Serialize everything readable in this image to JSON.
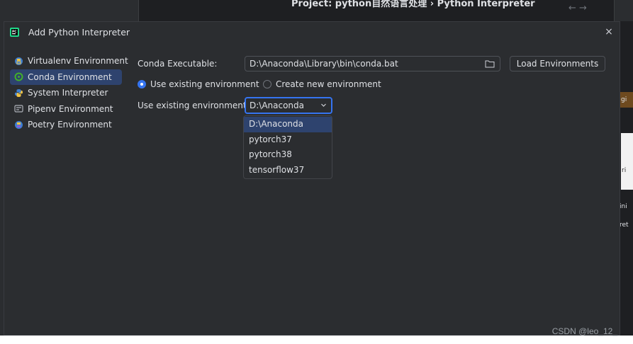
{
  "background": {
    "breadcrumb": "Project: python自然语言处理 › Python Interpreter",
    "nav_arrows": "← →",
    "right_fragments": [
      "gi",
      "ri",
      "ini",
      "ret"
    ]
  },
  "dialog": {
    "title": "Add Python Interpreter",
    "close_label": "×"
  },
  "sidebar": {
    "items": [
      {
        "label": "Virtualenv Environment",
        "icon": "virtualenv-icon",
        "selected": false
      },
      {
        "label": "Conda Environment",
        "icon": "conda-icon",
        "selected": true
      },
      {
        "label": "System Interpreter",
        "icon": "python-icon",
        "selected": false
      },
      {
        "label": "Pipenv Environment",
        "icon": "pipenv-icon",
        "selected": false
      },
      {
        "label": "Poetry Environment",
        "icon": "poetry-icon",
        "selected": false
      }
    ]
  },
  "form": {
    "conda_executable_label": "Conda Executable:",
    "conda_executable_value": "D:\\Anaconda\\Library\\bin\\conda.bat",
    "load_button": "Load Environments",
    "radio_existing": "Use existing environment",
    "radio_new": "Create new environment",
    "existing_env_label": "Use existing environment:",
    "existing_env_value": "D:\\Anaconda",
    "env_options": [
      "D:\\Anaconda",
      "pytorch37",
      "pytorch38",
      "tensorflow37"
    ],
    "selected_option_index": 0
  },
  "watermark": "CSDN @leo_12_",
  "colors": {
    "accent": "#3574f0",
    "selection": "#2e436e",
    "dialog_bg": "#2b2d30",
    "text": "#dfe1e5"
  }
}
